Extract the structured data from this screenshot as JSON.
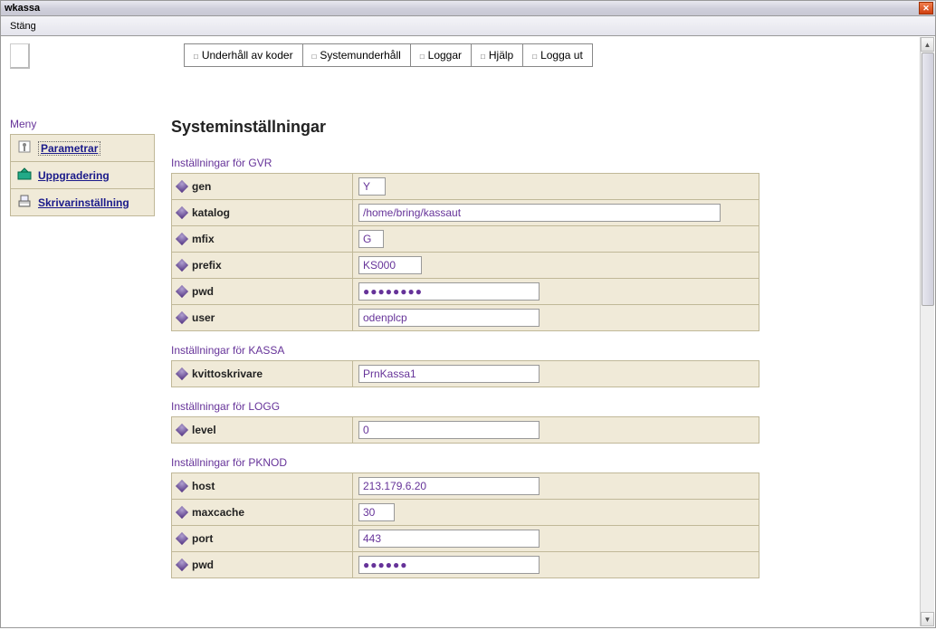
{
  "window": {
    "title": "wkassa"
  },
  "menubar": {
    "close": "Stäng"
  },
  "topnav": {
    "items": [
      "Underhåll av koder",
      "Systemunderhåll",
      "Loggar",
      "Hjälp",
      "Logga ut"
    ]
  },
  "sidebar": {
    "title": "Meny",
    "items": [
      {
        "label": "Parametrar",
        "active": true
      },
      {
        "label": "Uppgradering",
        "active": false
      },
      {
        "label": "Skrivarinställning",
        "active": false
      }
    ]
  },
  "page": {
    "heading": "Systeminställningar",
    "sections": [
      {
        "title": "Inställningar för GVR",
        "rows": [
          {
            "label": "gen",
            "value": "Y",
            "w": "w-y"
          },
          {
            "label": "katalog",
            "value": "/home/bring/kassaut",
            "w": "w-long"
          },
          {
            "label": "mfix",
            "value": "G",
            "w": "w-g"
          },
          {
            "label": "prefix",
            "value": "KS000",
            "w": "w-prefix"
          },
          {
            "label": "pwd",
            "value": "●●●●●●●●",
            "w": "w-med",
            "password": true
          },
          {
            "label": "user",
            "value": "odenplcp",
            "w": "w-med"
          }
        ]
      },
      {
        "title": "Inställningar för KASSA",
        "rows": [
          {
            "label": "kvittoskrivare",
            "value": "PrnKassa1",
            "w": "w-med"
          }
        ]
      },
      {
        "title": "Inställningar för LOGG",
        "rows": [
          {
            "label": "level",
            "value": "0",
            "w": "w-med"
          }
        ]
      },
      {
        "title": "Inställningar för PKNOD",
        "rows": [
          {
            "label": "host",
            "value": "213.179.6.20",
            "w": "w-med"
          },
          {
            "label": "maxcache",
            "value": "30",
            "w": "w-num"
          },
          {
            "label": "port",
            "value": "443",
            "w": "w-med"
          },
          {
            "label": "pwd",
            "value": "●●●●●●",
            "w": "w-med",
            "password": true
          }
        ]
      }
    ]
  }
}
